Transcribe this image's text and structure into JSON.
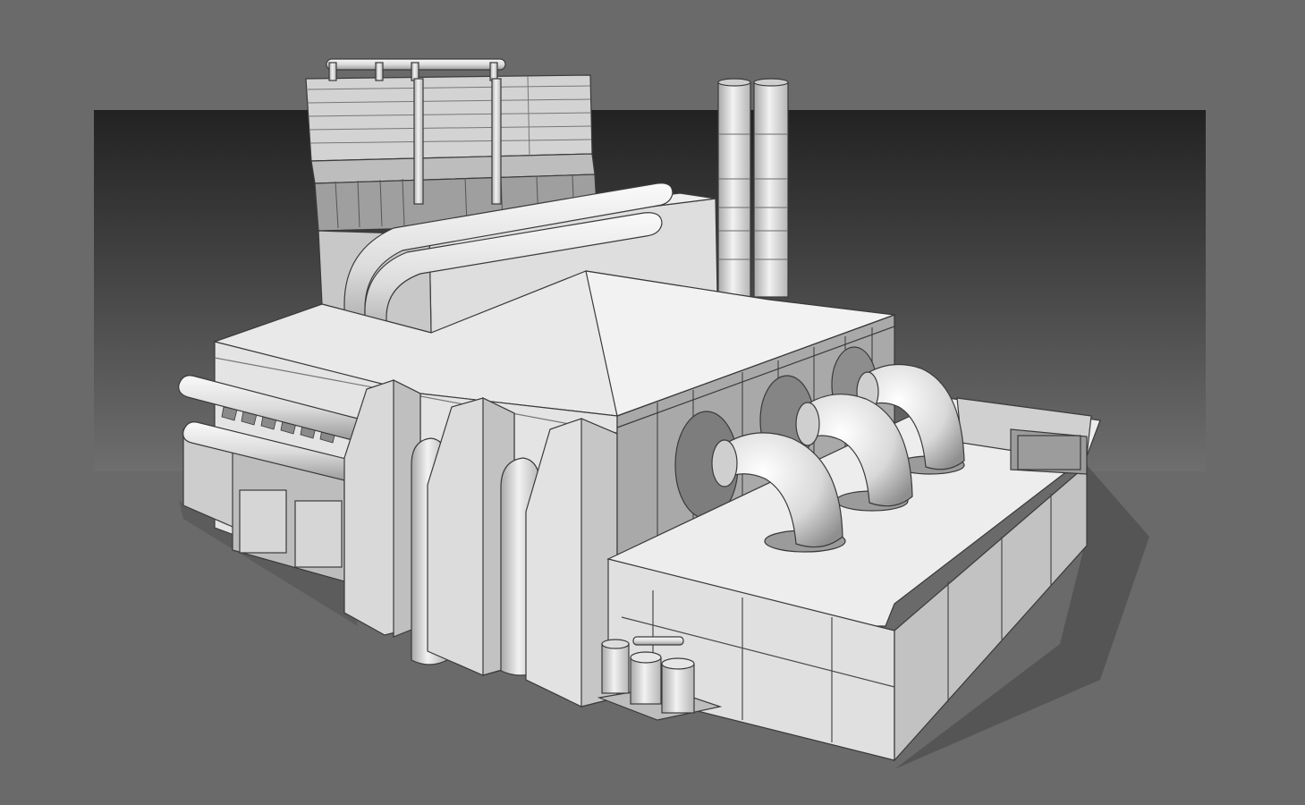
{
  "scene": {
    "subject": "industrial-plant-3d-render",
    "colors": {
      "canvas": "#6a6a6a",
      "backdrop_top": "#222222",
      "backdrop_bottom": "#6e6e6e",
      "surface_light": "#efefef",
      "surface_mid": "#d6d6d6",
      "surface_dark": "#a9a9a9",
      "outline": "#3a3a3a",
      "shadow": "#555555"
    }
  }
}
